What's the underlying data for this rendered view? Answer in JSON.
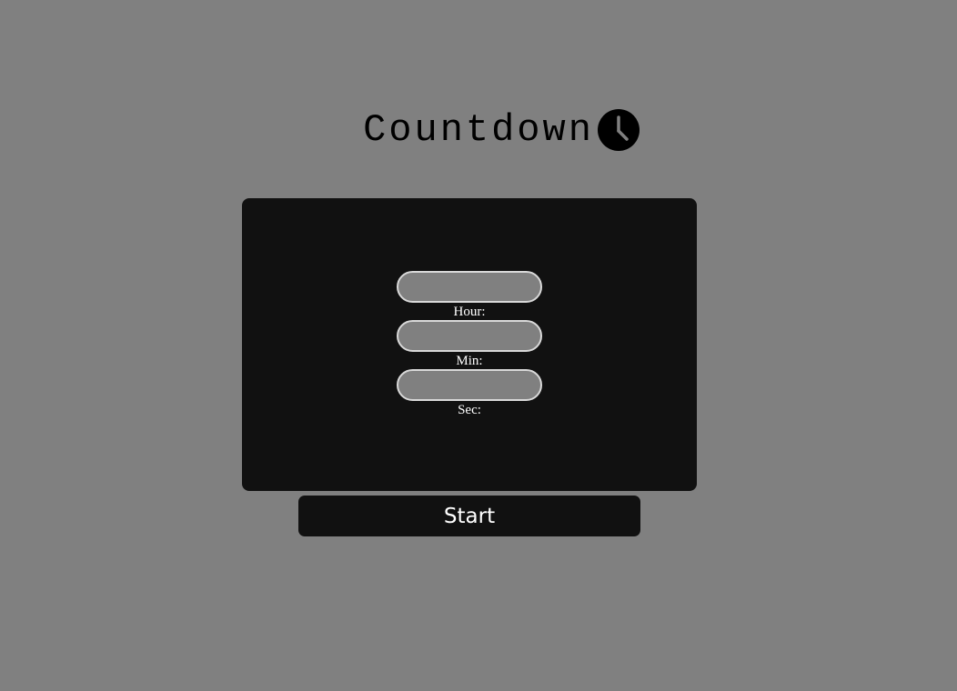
{
  "header": {
    "title": "Countdown",
    "icon": "clock-icon"
  },
  "form": {
    "fields": [
      {
        "label": "Hour:",
        "value": "",
        "placeholder": ""
      },
      {
        "label": "Min:",
        "value": "",
        "placeholder": ""
      },
      {
        "label": "Sec:",
        "value": "",
        "placeholder": ""
      }
    ]
  },
  "actions": {
    "start_label": "Start"
  },
  "colors": {
    "background": "#808080",
    "panel": "#111111",
    "input_fill": "#808080",
    "input_border": "#d9d9d9",
    "text_light": "#ffffff",
    "text_dark": "#000000"
  }
}
